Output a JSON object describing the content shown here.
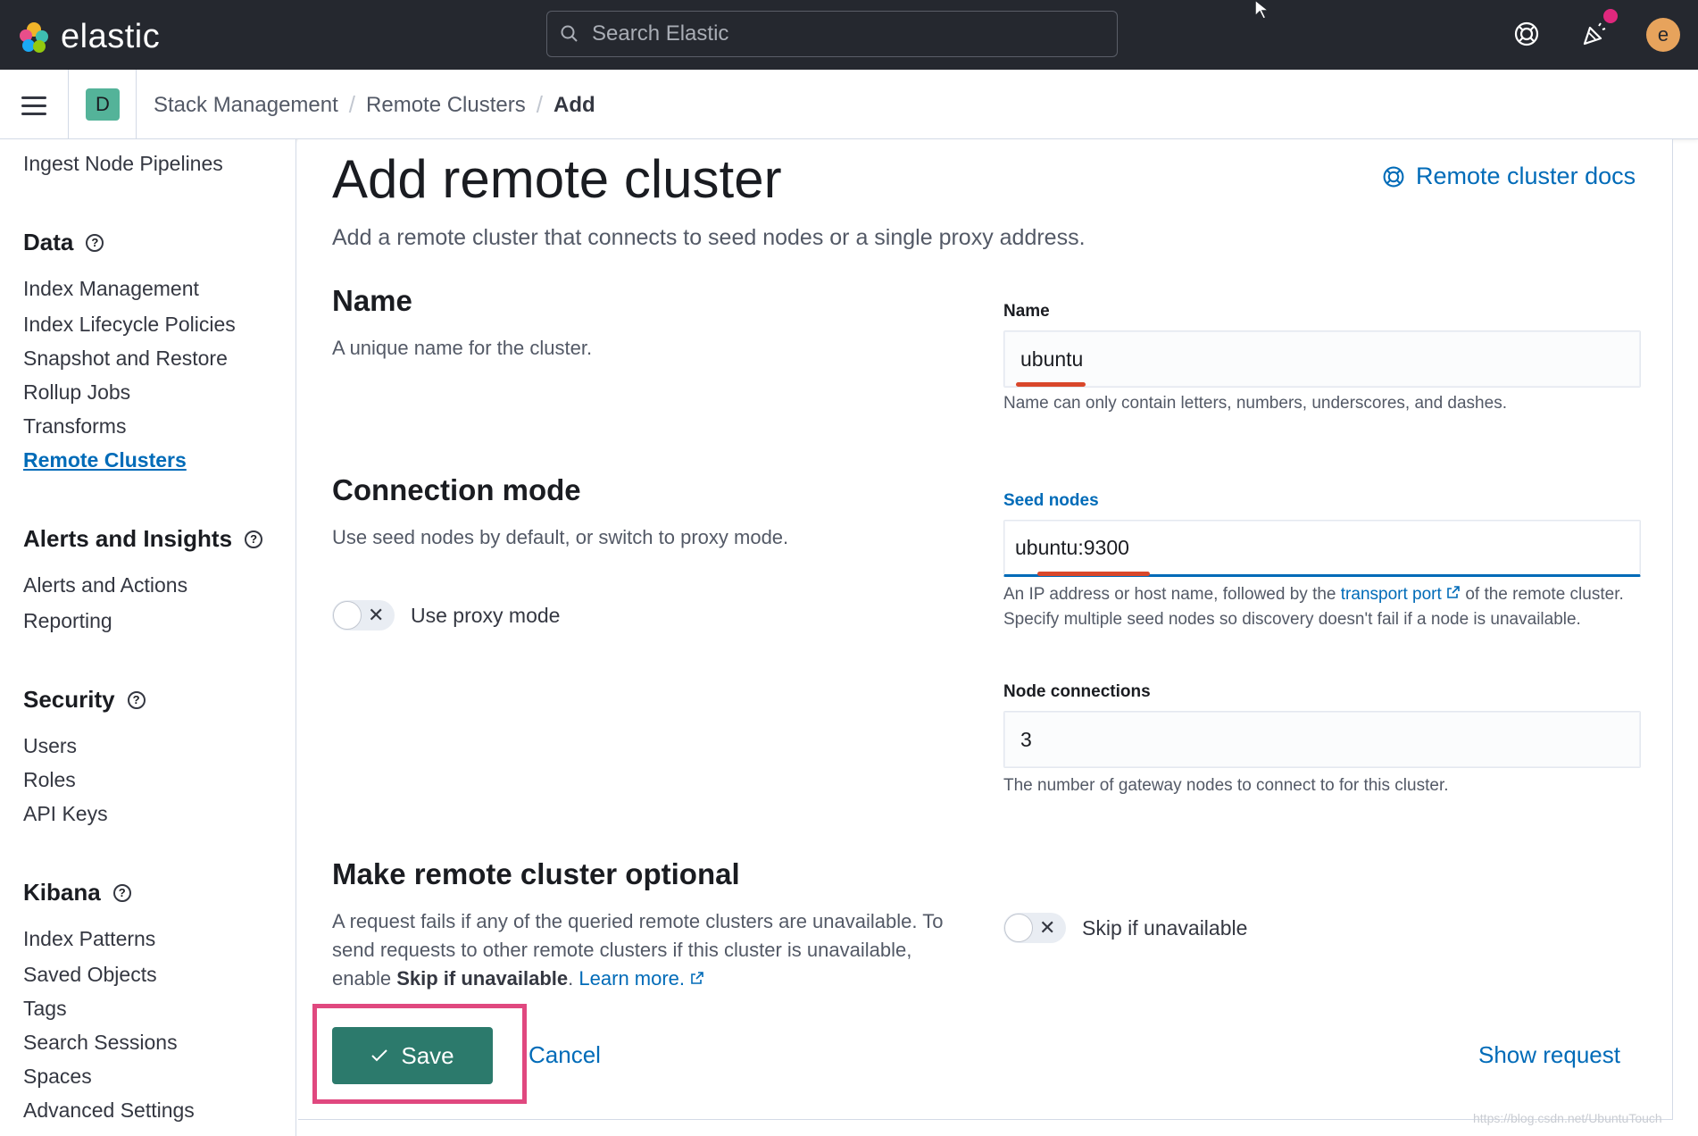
{
  "header": {
    "brand": "elastic",
    "search_placeholder": "Search Elastic",
    "avatar_initial": "e"
  },
  "breadcrumb": {
    "space_initial": "D",
    "items": [
      "Stack Management",
      "Remote Clusters",
      "Add"
    ]
  },
  "sidebar": {
    "top_item": "Ingest Node Pipelines",
    "sections": [
      {
        "title": "Data",
        "items": [
          "Index Management",
          "Index Lifecycle Policies",
          "Snapshot and Restore",
          "Rollup Jobs",
          "Transforms",
          "Remote Clusters"
        ]
      },
      {
        "title": "Alerts and Insights",
        "items": [
          "Alerts and Actions",
          "Reporting"
        ]
      },
      {
        "title": "Security",
        "items": [
          "Users",
          "Roles",
          "API Keys"
        ]
      },
      {
        "title": "Kibana",
        "items": [
          "Index Patterns",
          "Saved Objects",
          "Tags",
          "Search Sessions",
          "Spaces",
          "Advanced Settings"
        ]
      }
    ],
    "active_item": "Remote Clusters"
  },
  "page": {
    "title": "Add remote cluster",
    "description": "Add a remote cluster that connects to seed nodes or a single proxy address.",
    "docs_link": "Remote cluster docs"
  },
  "name_section": {
    "title": "Name",
    "description": "A unique name for the cluster.",
    "field_label": "Name",
    "field_value": "ubuntu",
    "help": "Name can only contain letters, numbers, underscores, and dashes."
  },
  "connection_section": {
    "title": "Connection mode",
    "description": "Use seed nodes by default, or switch to proxy mode.",
    "toggle_label": "Use proxy mode",
    "seed_label": "Seed nodes",
    "seed_value": "ubuntu:9300",
    "seed_help_prefix": "An IP address or host name, followed by the",
    "seed_help_link": "transport port",
    "seed_help_suffix": "of the remote cluster. Specify multiple seed nodes so discovery doesn't fail if a node is unavailable.",
    "node_conn_label": "Node connections",
    "node_conn_value": "3",
    "node_conn_help": "The number of gateway nodes to connect to for this cluster."
  },
  "optional_section": {
    "title": "Make remote cluster optional",
    "desc_part1": "A request fails if any of the queried remote clusters are unavailable. To send requests to other remote clusters if this cluster is unavailable, enable",
    "desc_bold": "Skip if unavailable",
    "desc_period": ".",
    "learn_more": "Learn more.",
    "toggle_label": "Skip if unavailable"
  },
  "footer": {
    "save": "Save",
    "cancel": "Cancel",
    "show_request": "Show request"
  },
  "watermark": "https://blog.csdn.net/UbuntuTouch",
  "colors": {
    "header_bg": "#25282f",
    "link": "#006bb8",
    "save_button": "#2c7a6c",
    "highlight_box": "#e0487f",
    "annotation_underline": "#d9472b",
    "space_badge": "#54b399"
  }
}
